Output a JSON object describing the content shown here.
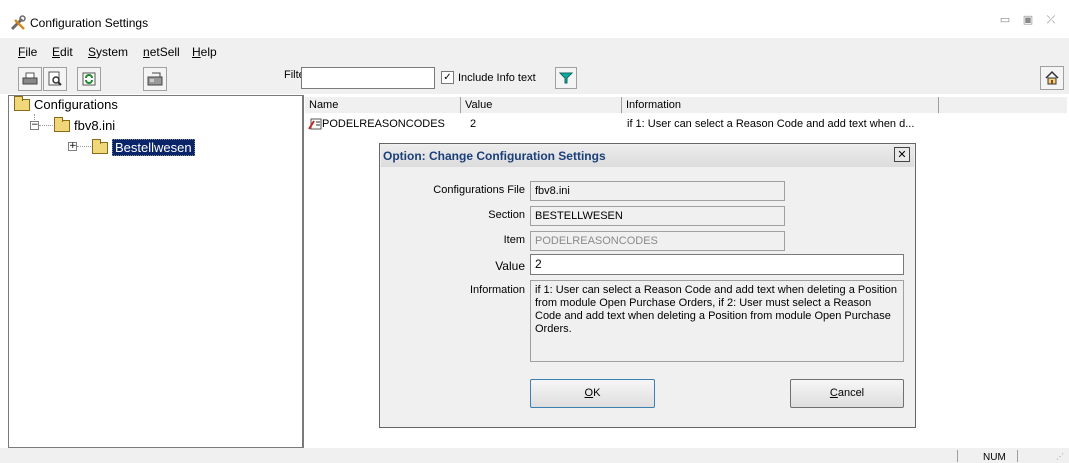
{
  "window": {
    "title": "Configuration Settings"
  },
  "menu": [
    {
      "label": "File",
      "u": "F",
      "rest": "ile"
    },
    {
      "label": "Edit",
      "u": "E",
      "rest": "dit"
    },
    {
      "label": "System",
      "u": "S",
      "rest": "ystem"
    },
    {
      "label": "netSell",
      "u": "n",
      "rest": "etSell"
    },
    {
      "label": "Help",
      "u": "H",
      "rest": "elp"
    }
  ],
  "toolbar": {
    "filter_label": "Filter",
    "filter_value": "",
    "include_info_label": "Include Info text",
    "include_info_checked": true
  },
  "tree": {
    "root": "Configurations",
    "child": "fbv8.ini",
    "grandchild": "Bestellwesen"
  },
  "list": {
    "columns": [
      "Name",
      "Value",
      "Information"
    ],
    "rows": [
      {
        "name": "PODELREASONCODES",
        "value": "2",
        "information": "if 1: User can select a Reason Code and add text when d..."
      }
    ]
  },
  "dialog": {
    "title": "Option: Change Configuration Settings",
    "labels": {
      "file": "Configurations File",
      "section": "Section",
      "item": "Item",
      "value": "Value",
      "information": "Information"
    },
    "values": {
      "file": "fbv8.ini",
      "section": "BESTELLWESEN",
      "item": "PODELREASONCODES",
      "value": "2",
      "information": "if 1: User can select a Reason Code and add text when deleting a Position from module Open Purchase Orders, if 2: User must select a Reason Code and add text when deleting a Position from module Open Purchase Orders."
    },
    "ok_u": "O",
    "ok_rest": "K",
    "cancel_u": "C",
    "cancel_rest": "ancel"
  },
  "status": {
    "num": "NUM"
  },
  "colors": {
    "selection": "#0a246a",
    "dialog_title_text": "#1a3f7a",
    "filter_icon": "#13a89e"
  }
}
